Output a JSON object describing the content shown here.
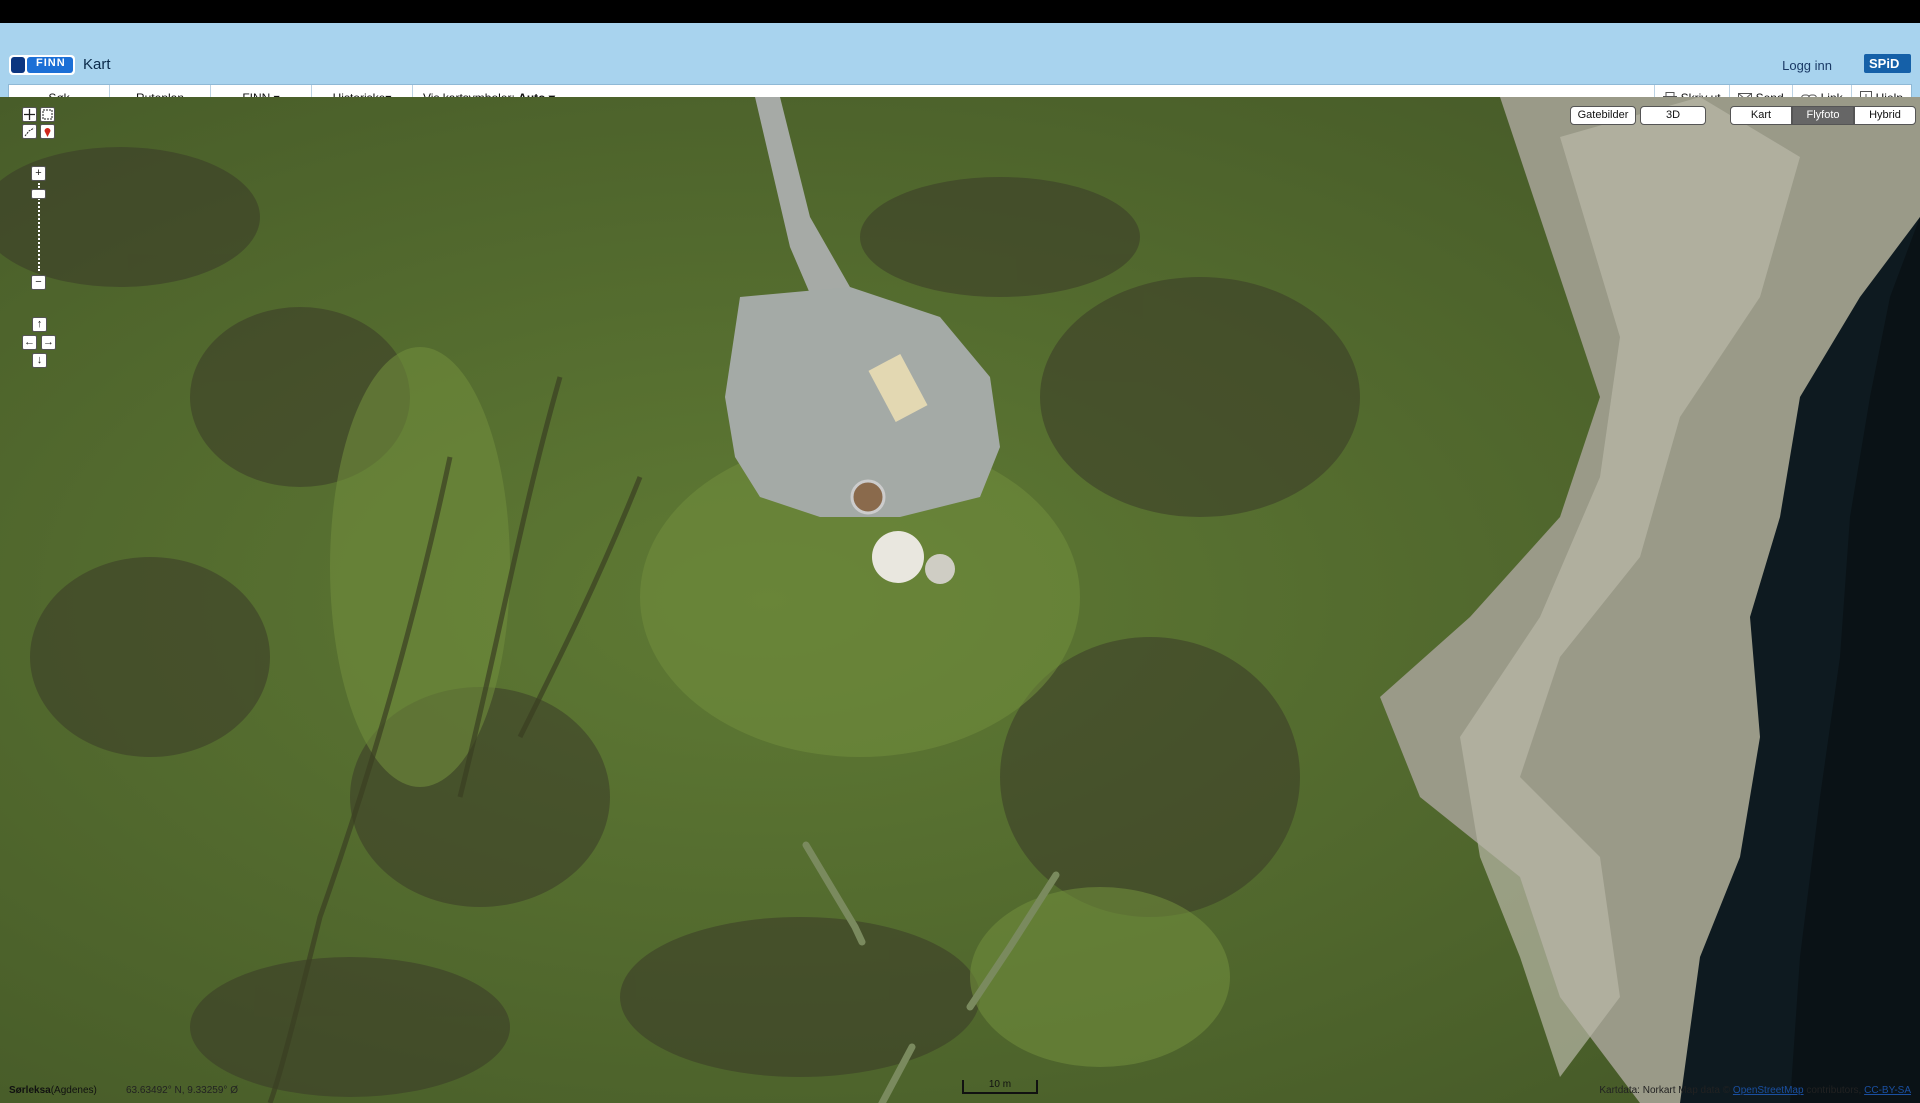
{
  "header": {
    "logo_text": "FINN",
    "title": "Kart",
    "login": "Logg inn",
    "spid": "SPiD"
  },
  "toolbar": {
    "sok": "Søk",
    "ruteplan": "Ruteplan",
    "finn": "FINN ▾",
    "historiske": "Historiske▾",
    "vis_label": "Vis kartsymboler:",
    "vis_value": "Auto ▾",
    "print": "Skriv ut",
    "send": "Send",
    "link": "Link",
    "help": "Hjelp"
  },
  "map_controls": {
    "zoom_in": "+",
    "zoom_out": "−",
    "pan_up": "↑",
    "pan_down": "↓",
    "pan_left": "←",
    "pan_right": "→"
  },
  "map_types": {
    "gatebilder": "Gatebilder",
    "three_d": "3D",
    "kart": "Kart",
    "flyfoto": "Flyfoto",
    "hybrid": "Hybrid",
    "active": "Flyfoto"
  },
  "status": {
    "place": "Sørleksa",
    "place_sub": "(Agdenes)",
    "coords": "63.63492° N, 9.33259° Ø"
  },
  "scale": {
    "label": "10 m"
  },
  "attribution": {
    "prefix": "Kartdata: Norkart Map data ©",
    "link1": "OpenStreetMap",
    "mid": "contributors,",
    "link2": "CC-BY-SA"
  },
  "colors": {
    "header_bg": "#a8d3ee",
    "active_maptype_bg": "#666666"
  }
}
